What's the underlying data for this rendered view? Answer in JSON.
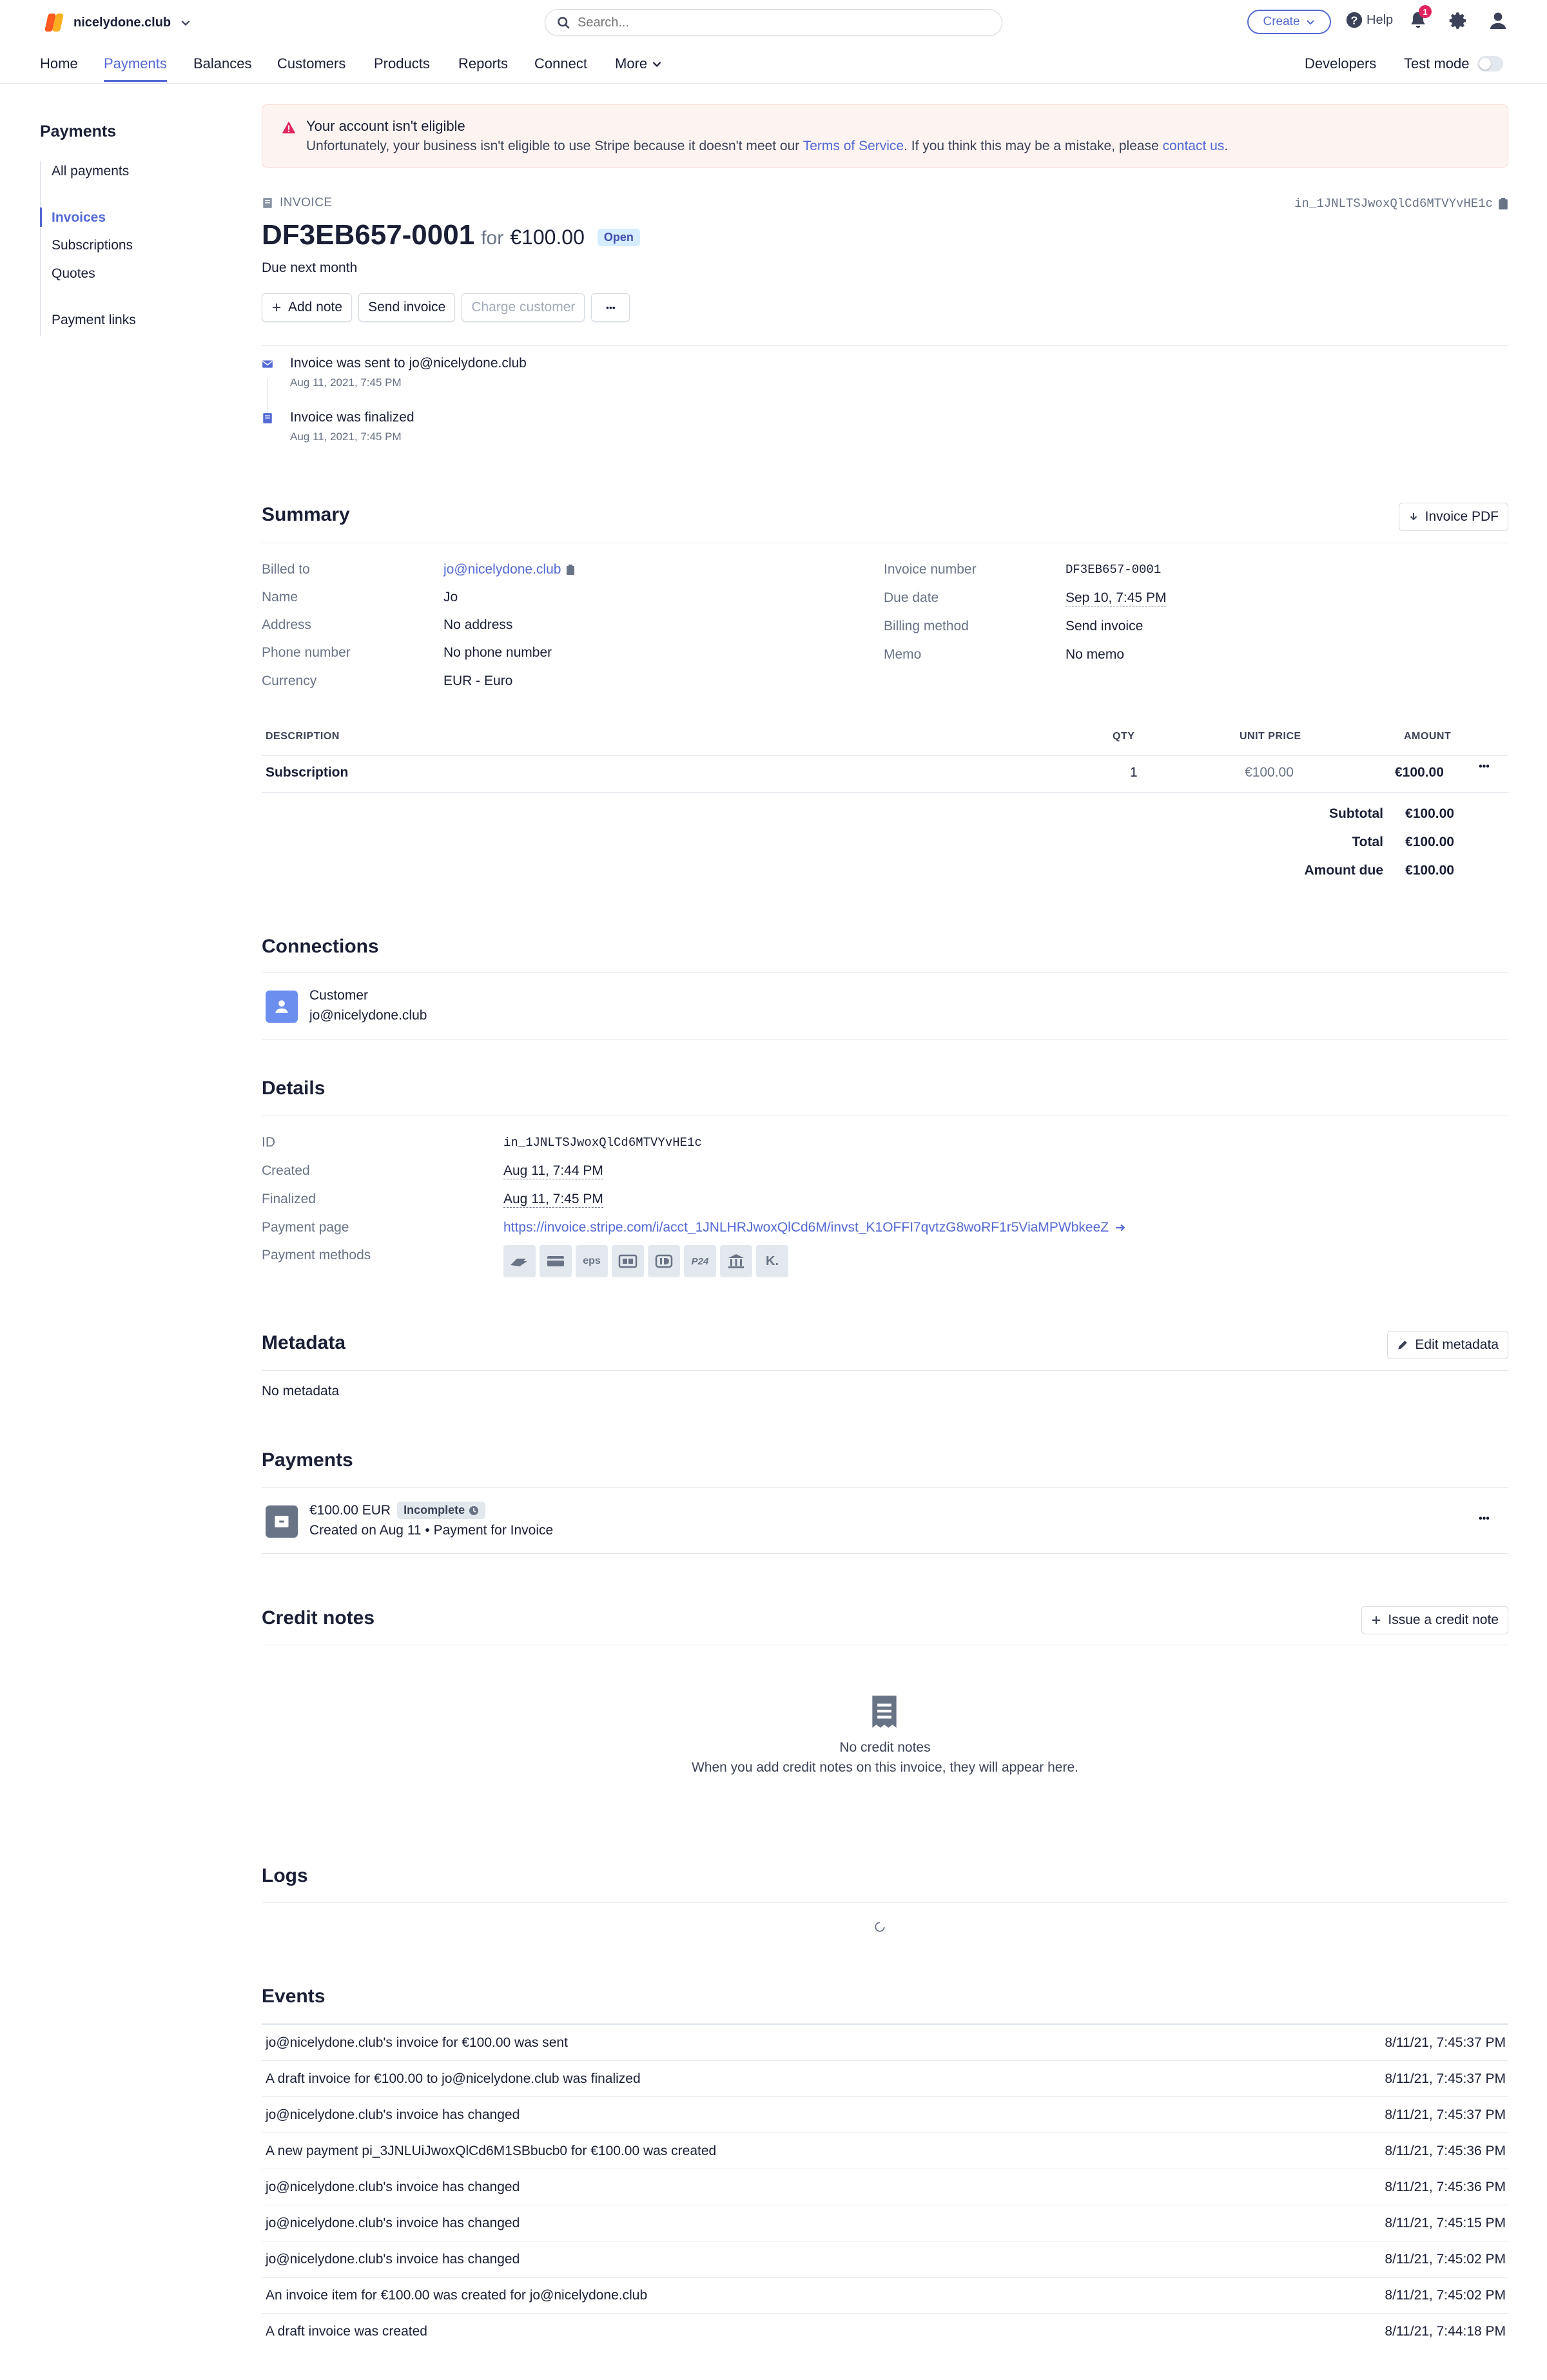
{
  "topbar": {
    "account_name": "nicelydone.club",
    "search_placeholder": "Search...",
    "create_label": "Create",
    "help_label": "Help",
    "notification_count": "1"
  },
  "nav": {
    "items": [
      "Home",
      "Payments",
      "Balances",
      "Customers",
      "Products",
      "Reports",
      "Connect",
      "More"
    ],
    "active": "Payments",
    "developers": "Developers",
    "test_mode": "Test mode"
  },
  "sidebar": {
    "title": "Payments",
    "items": [
      "All payments",
      "Invoices",
      "Subscriptions",
      "Quotes",
      "Payment links"
    ],
    "active": "Invoices"
  },
  "alert": {
    "title": "Your account isn't eligible",
    "text_before": "Unfortunately, your business isn't eligible to use Stripe because it doesn't meet our ",
    "tos_link": "Terms of Service",
    "text_middle": ". If you think this may be a mistake, please ",
    "contact_link": "contact us",
    "text_after": "."
  },
  "invoice": {
    "label": "INVOICE",
    "id": "in_1JNLTSJwoxQlCd6MTVYvHE1c",
    "number": "DF3EB657-0001",
    "for_word": "for",
    "amount": "€100.00",
    "status": "Open",
    "due_text": "Due next month",
    "buttons": {
      "add_note": "Add note",
      "send_invoice": "Send invoice",
      "charge_customer": "Charge customer",
      "more": "•••"
    }
  },
  "timeline": [
    {
      "text_prefix": "Invoice was sent to ",
      "text_strong": "jo@nicelydone.club",
      "date": "Aug 11, 2021, 7:45 PM"
    },
    {
      "text_prefix": "Invoice was finalized",
      "text_strong": "",
      "date": "Aug 11, 2021, 7:45 PM"
    }
  ],
  "summary": {
    "title": "Summary",
    "pdf_button": "Invoice PDF",
    "left": [
      {
        "label": "Billed to",
        "value": "jo@nicelydone.club"
      },
      {
        "label": "Name",
        "value": "Jo"
      },
      {
        "label": "Address",
        "value": "No address"
      },
      {
        "label": "Phone number",
        "value": "No phone number"
      },
      {
        "label": "Currency",
        "value": "EUR - Euro"
      }
    ],
    "right": [
      {
        "label": "Invoice number",
        "value": "DF3EB657-0001"
      },
      {
        "label": "Due date",
        "value": "Sep 10, 7:45 PM"
      },
      {
        "label": "Billing method",
        "value": "Send invoice"
      },
      {
        "label": "Memo",
        "value": "No memo"
      }
    ],
    "table": {
      "headers": [
        "DESCRIPTION",
        "QTY",
        "UNIT PRICE",
        "AMOUNT"
      ],
      "row": {
        "description": "Subscription",
        "qty": "1",
        "unit_price": "€100.00",
        "amount": "€100.00"
      }
    },
    "totals": [
      {
        "label": "Subtotal",
        "value": "€100.00"
      },
      {
        "label": "Total",
        "value": "€100.00"
      },
      {
        "label": "Amount due",
        "value": "€100.00"
      }
    ]
  },
  "connections": {
    "title": "Connections",
    "type": "Customer",
    "email": "jo@nicelydone.club"
  },
  "details": {
    "title": "Details",
    "rows": [
      {
        "label": "ID",
        "value": "in_1JNLTSJwoxQlCd6MTVYvHE1c"
      },
      {
        "label": "Created",
        "value": "Aug 11, 7:44 PM"
      },
      {
        "label": "Finalized",
        "value": "Aug 11, 7:45 PM"
      },
      {
        "label": "Payment page",
        "value": "https://invoice.stripe.com/i/acct_1JNLHRJwoxQlCd6M/invst_K1OFFI7qvtzG8woRF1r5ViaMPWbkeeZ"
      },
      {
        "label": "Payment methods",
        "value": ""
      }
    ],
    "payment_method_icons": [
      "card-swipe-icon",
      "card-icon",
      "eps-icon",
      "p24-wallet-icon",
      "ideal-icon",
      "p24-icon",
      "bank-icon",
      "klarna-icon"
    ]
  },
  "metadata": {
    "title": "Metadata",
    "edit_button": "Edit metadata",
    "empty": "No metadata"
  },
  "payments": {
    "title": "Payments",
    "amount": "€100.00 EUR",
    "status": "Incomplete",
    "subtitle": "Created on Aug 11 • Payment for Invoice"
  },
  "credit_notes": {
    "title": "Credit notes",
    "issue_button": "Issue a credit note",
    "empty_title": "No credit notes",
    "empty_text": "When you add credit notes on this invoice, they will appear here."
  },
  "logs": {
    "title": "Logs"
  },
  "events": {
    "title": "Events",
    "rows": [
      {
        "message": "jo@nicelydone.club's invoice for €100.00 was sent",
        "time": "8/11/21, 7:45:37 PM"
      },
      {
        "message": "A draft invoice for €100.00 to jo@nicelydone.club was finalized",
        "time": "8/11/21, 7:45:37 PM"
      },
      {
        "message": "jo@nicelydone.club's invoice has changed",
        "time": "8/11/21, 7:45:37 PM"
      },
      {
        "message": "A new payment pi_3JNLUiJwoxQlCd6M1SBbucb0 for €100.00 was created",
        "time": "8/11/21, 7:45:36 PM"
      },
      {
        "message": "jo@nicelydone.club's invoice has changed",
        "time": "8/11/21, 7:45:36 PM"
      },
      {
        "message": "jo@nicelydone.club's invoice has changed",
        "time": "8/11/21, 7:45:15 PM"
      },
      {
        "message": "jo@nicelydone.club's invoice has changed",
        "time": "8/11/21, 7:45:02 PM"
      },
      {
        "message": "An invoice item for €100.00 was created for jo@nicelydone.club",
        "time": "8/11/21, 7:45:02 PM"
      },
      {
        "message": "A draft invoice was created",
        "time": "8/11/21, 7:44:18 PM"
      }
    ]
  },
  "colors": {
    "accent": "#5469d4",
    "alert_bg": "#fdf4f1",
    "danger": "#e0245e",
    "open_pill": "#d6ecff"
  }
}
